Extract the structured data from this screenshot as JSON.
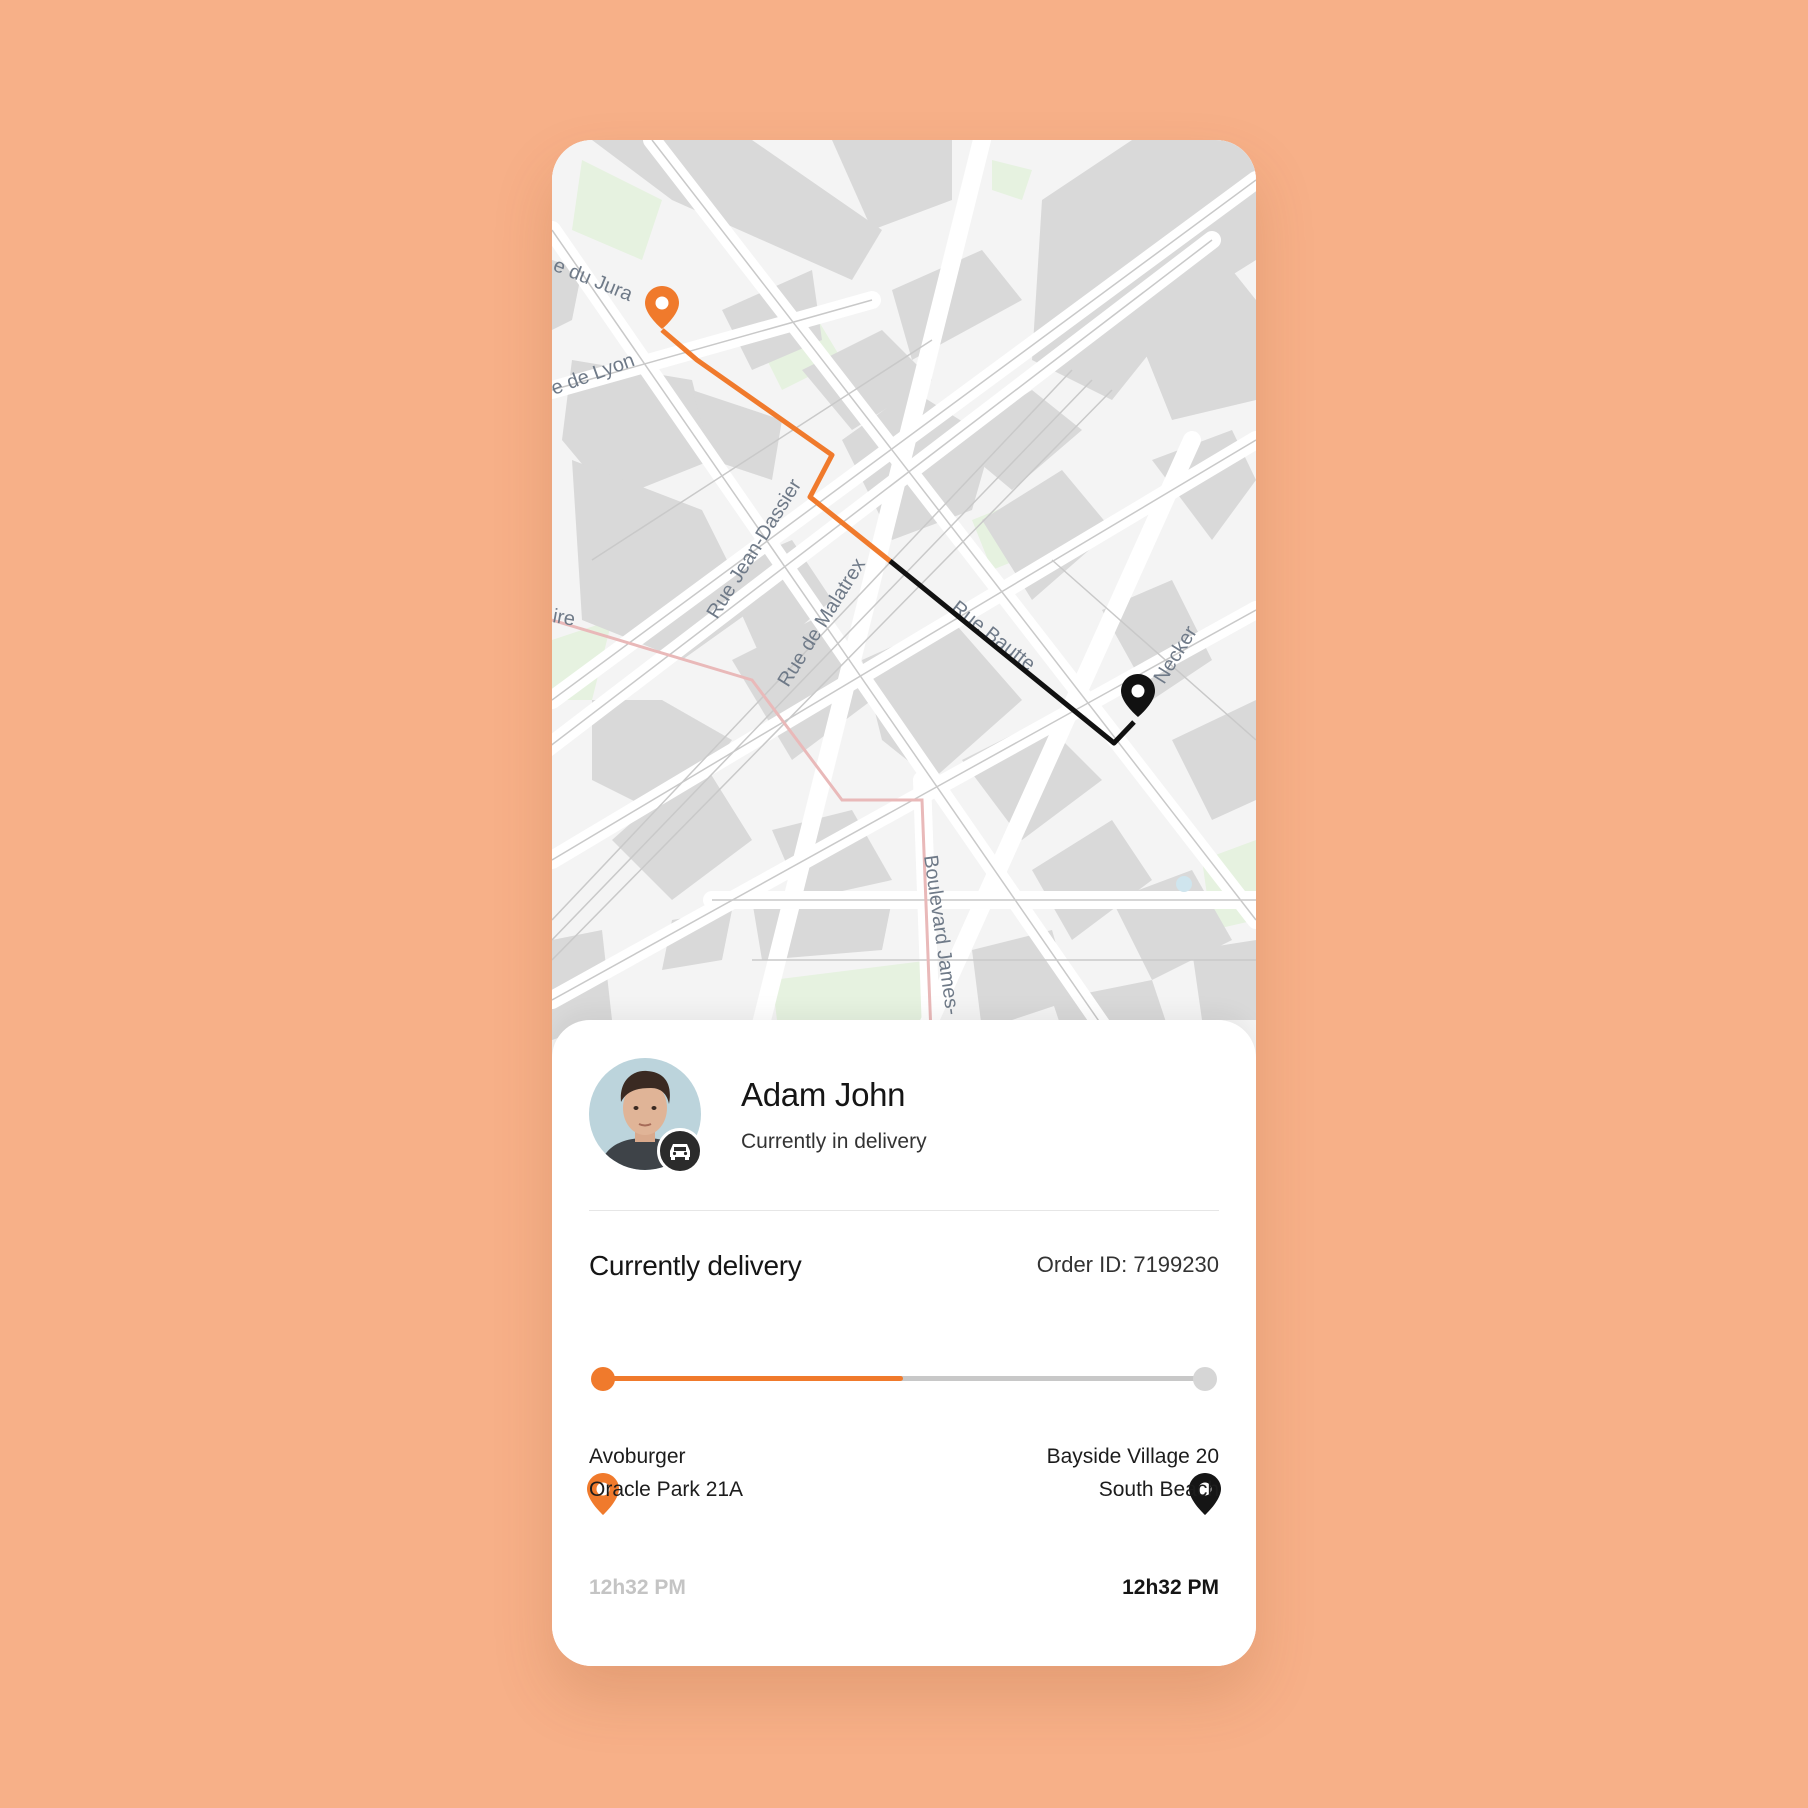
{
  "driver": {
    "name": "Adam John",
    "status": "Currently in delivery"
  },
  "delivery": {
    "title": "Currently delivery",
    "order_id": "Order ID: 7199230",
    "progress": 0.5,
    "origin": {
      "line1": "Avoburger",
      "line2": "Oracle Park 21A",
      "time": "12h32 PM"
    },
    "destination": {
      "line1": "Bayside Village 20",
      "line2": "South Beach",
      "time": "12h32 PM"
    }
  },
  "map": {
    "street_labels": [
      "e du Jura",
      "e de Lyon",
      "Rue Jean-Dassier",
      "Rue de Malatrex",
      "Boulevard James-",
      "Rue Bautte",
      "Necker",
      "ire"
    ]
  },
  "colors": {
    "background": "#f7b088",
    "accent": "#f07a2c",
    "dark": "#151515",
    "track": "#c8c8c8"
  },
  "icons": {
    "origin_pin": "map-pin-orange",
    "destination_pin": "map-pin-black",
    "vehicle": "car-icon"
  }
}
